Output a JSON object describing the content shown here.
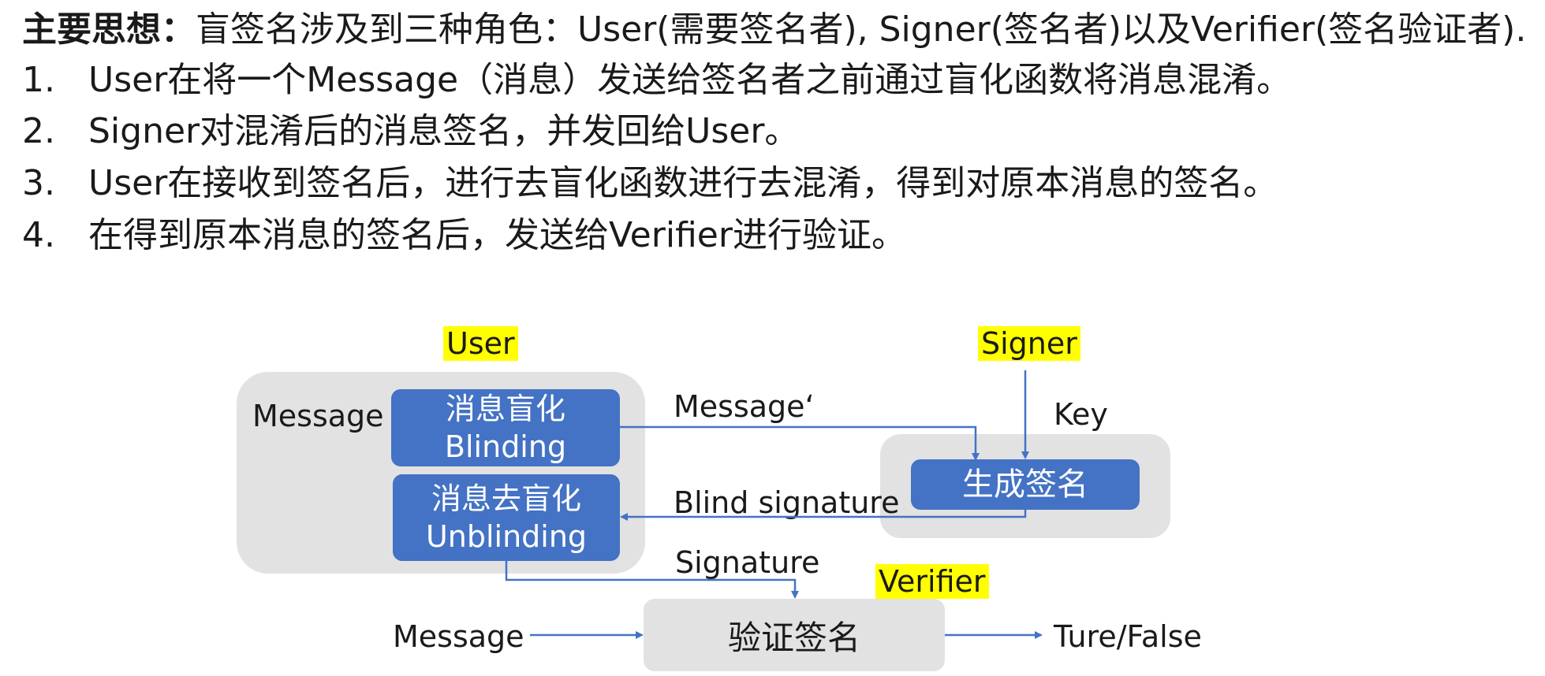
{
  "heading": {
    "bold": "主要思想：",
    "text": "盲签名涉及到三种角色：User(需要签名者), Signer(签名者)以及Verifier(签名验证者)."
  },
  "steps": [
    {
      "num": "1.",
      "text": "User在将一个Message（消息）发送给签名者之前通过盲化函数将消息混淆。"
    },
    {
      "num": "2.",
      "text": "Signer对混淆后的消息签名，并发回给User。"
    },
    {
      "num": "3.",
      "text": "User在接收到签名后，进行去盲化函数进行去混淆，得到对原本消息的签名。"
    },
    {
      "num": "4.",
      "text": "在得到原本消息的签名后，发送给Verifier进行验证。"
    }
  ],
  "diagram": {
    "roles": {
      "user": "User",
      "signer": "Signer",
      "verifier": "Verifier"
    },
    "message_label": "Message",
    "blinding": {
      "cn": "消息盲化",
      "en": "Blinding"
    },
    "unblinding": {
      "cn": "消息去盲化",
      "en": "Unblinding"
    },
    "generate_signature": "生成签名",
    "key_label": "Key",
    "message_prime": "Message‘",
    "blind_signature": "Blind signature",
    "signature": "Signature",
    "verify_signature": "验证签名",
    "verify_input": "Message",
    "verify_output": "Ture/False"
  },
  "colors": {
    "highlight": "#ffff00",
    "box_blue": "#4472c4",
    "box_gray": "#e2e2e2",
    "arrow": "#4472c4"
  }
}
